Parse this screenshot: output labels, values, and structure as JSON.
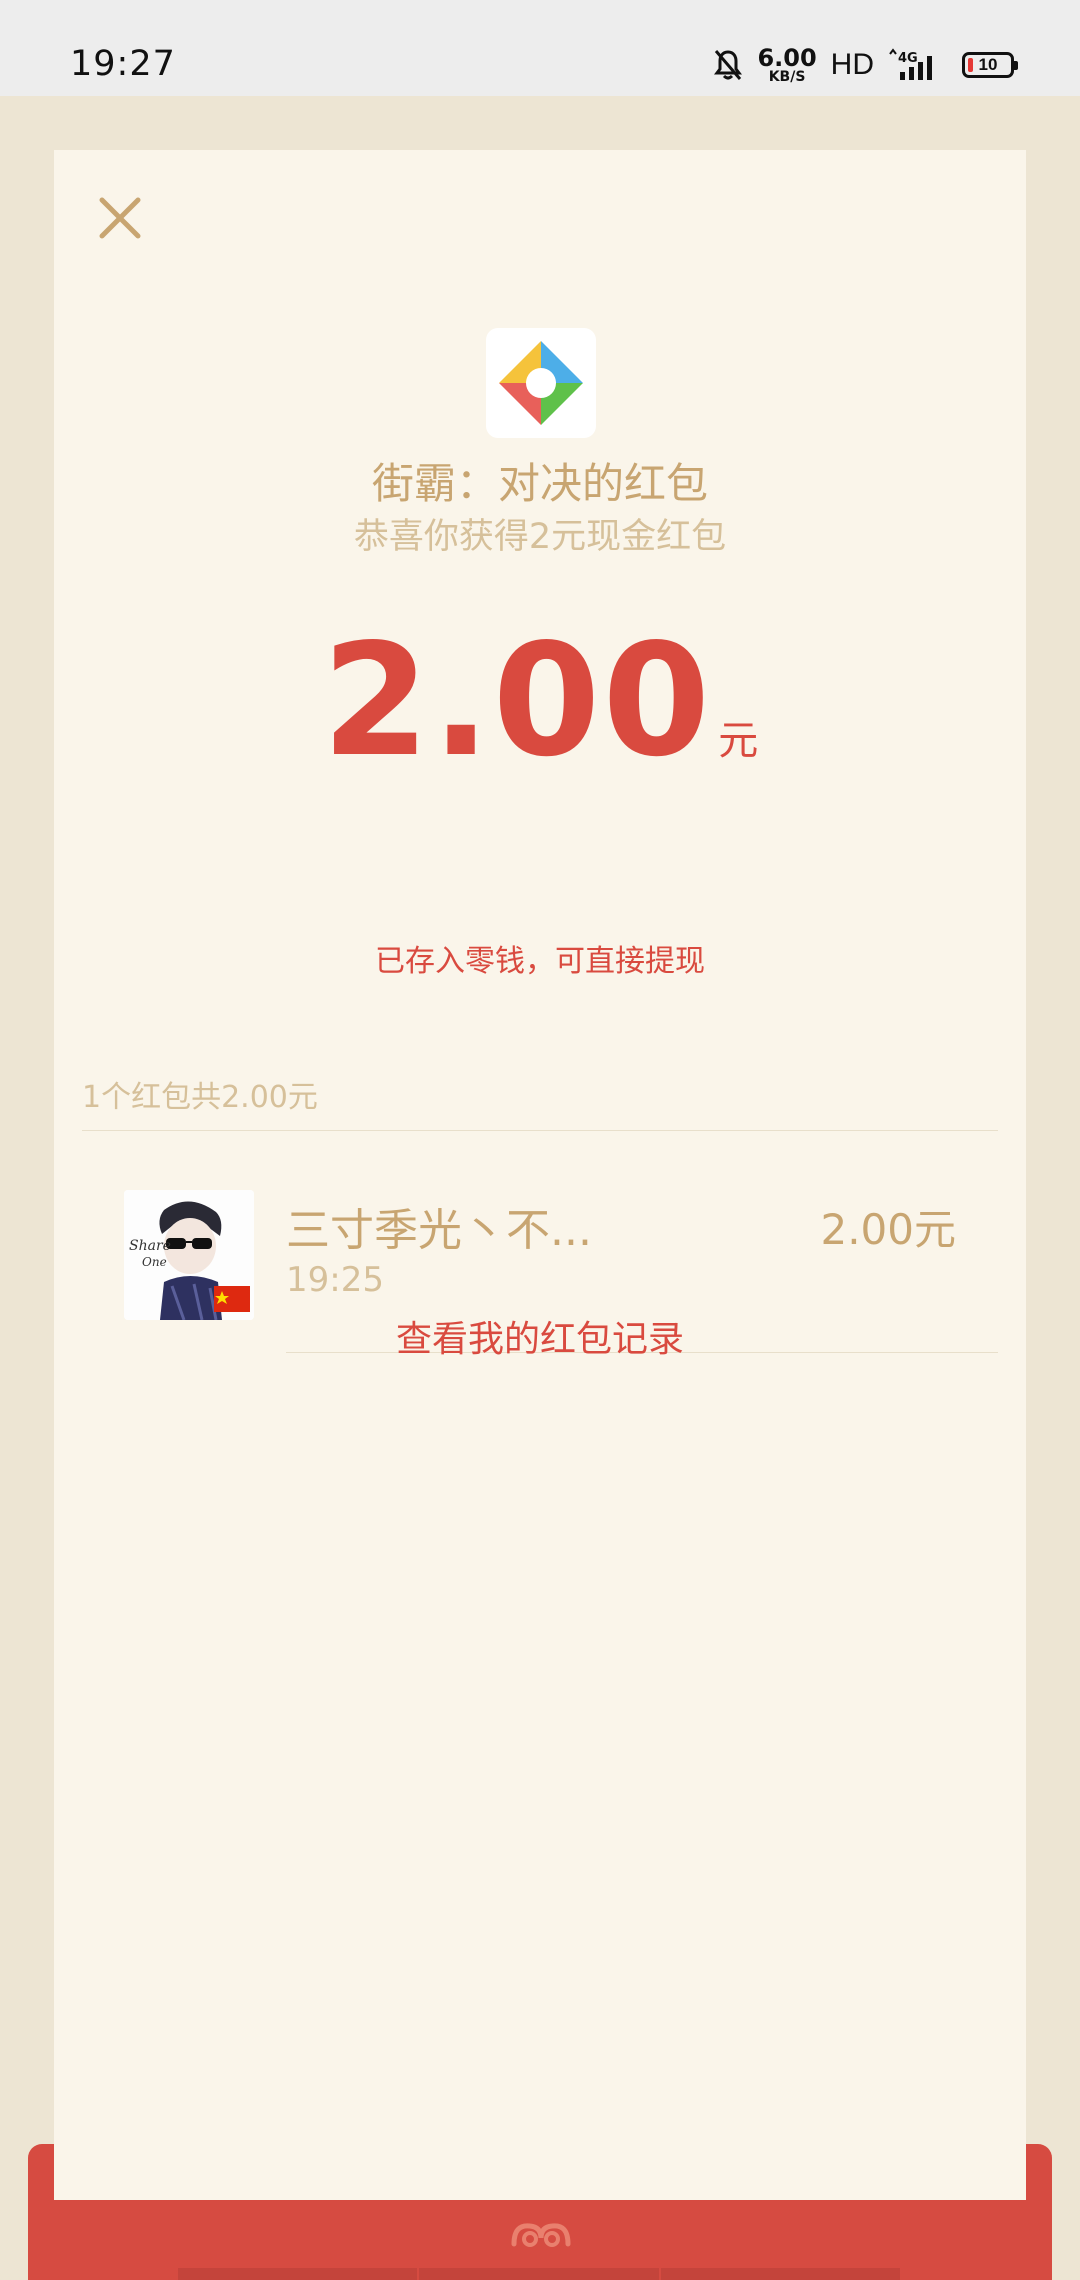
{
  "status_bar": {
    "time": "19:27",
    "speed_value": "6.00",
    "speed_unit": "KB/S",
    "hd": "HD",
    "network": "4G",
    "battery": "10"
  },
  "card": {
    "logo_icon": "colorful-diamond-logo-icon",
    "title": "街霸：对决的红包",
    "subtitle": "恭喜你获得2元现金红包",
    "amount": "2.00",
    "amount_unit": "元",
    "amount_note": "已存入零钱，可直接提现",
    "summary": "1个红包共2.00元",
    "records": [
      {
        "name": "三寸季光丶不...",
        "time": "19:25",
        "amount": "2.00元"
      }
    ],
    "view_records_link": "查看我的红包记录"
  },
  "colors": {
    "background": "#EDE5D3",
    "card": "#FAF5EA",
    "gold": "#C8A571",
    "light_gold": "#D6C09A",
    "red": "#D94A3F"
  }
}
